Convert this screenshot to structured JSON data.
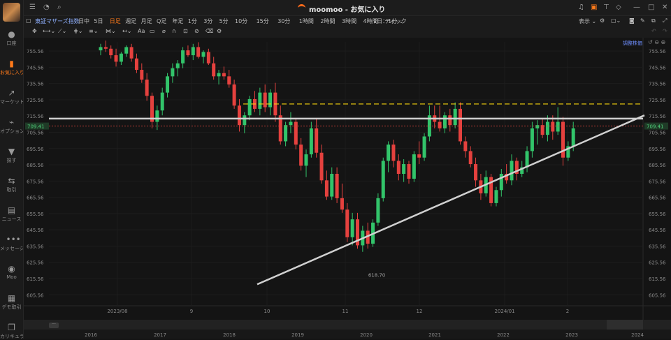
{
  "window": {
    "app_title": "moomoo - お気に入り",
    "icons": [
      "list-icon",
      "bell-icon",
      "search-icon",
      "headset-icon",
      "lock-icon",
      "shirt-icon",
      "bell-icon",
      "minimize-icon",
      "maximize-icon",
      "close-icon"
    ]
  },
  "sidebar": {
    "items": [
      {
        "label": "口座",
        "icon": "user-icon"
      },
      {
        "label": "お気に入り",
        "icon": "chart-bars-icon",
        "active": true
      },
      {
        "label": "マーケット",
        "icon": "trend-icon"
      },
      {
        "label": "オプション",
        "icon": "option-chart-icon"
      },
      {
        "label": "探す",
        "icon": "filter-icon"
      },
      {
        "label": "取引",
        "icon": "trade-icon"
      },
      {
        "label": "ニュース",
        "icon": "news-icon"
      },
      {
        "label": "メッセージ",
        "icon": "message-icon"
      },
      {
        "label": "Moo",
        "icon": "moo-icon"
      },
      {
        "label": "デモ取引",
        "icon": "game-icon"
      },
      {
        "label": "カリキュラム",
        "icon": "curriculum-icon"
      }
    ]
  },
  "toolbar": {
    "symbol": "東証マザーズ指数",
    "timeframes": [
      "日中",
      "5日",
      "日足",
      "週足",
      "月足",
      "Q足",
      "年足",
      "1分",
      "3分",
      "5分",
      "10分",
      "15分",
      "30分",
      "1時間",
      "2時間",
      "3時間",
      "4時間",
      "ティック"
    ],
    "active_timeframe": "日足",
    "interval_select": "1日：1分",
    "display_label": "表示",
    "adjust_label": "調整株価"
  },
  "chart_data": {
    "type": "candlestick",
    "price_axis_ticks": [
      755.56,
      745.56,
      735.56,
      725.56,
      715.56,
      705.56,
      695.56,
      685.56,
      675.56,
      665.56,
      655.56,
      645.56,
      635.56,
      625.56,
      615.56,
      605.56
    ],
    "current_price": "709.41",
    "time_labels": [
      "2023/08",
      "9",
      "10",
      "11",
      "12",
      "2024/01",
      "2"
    ],
    "navigator_years": [
      "2016",
      "2017",
      "2018",
      "2019",
      "2020",
      "2021",
      "2022",
      "2023",
      "2024"
    ],
    "annotations": {
      "low_label": "618.70"
    },
    "horizontal_lines": [
      {
        "style": "dashed",
        "color": "#f5d20c",
        "value": 723
      },
      {
        "style": "solid",
        "color": "#d0d0d0",
        "value": 714
      },
      {
        "style": "dotted",
        "color": "#d9433c",
        "value": 709.41
      }
    ],
    "trendline": {
      "color": "#d0d0d0",
      "from": [
        "2023/09/26",
        612
      ],
      "to": [
        "2024/02/20",
        716
      ]
    },
    "colors": {
      "up": "#32c46a",
      "down": "#e5413e"
    },
    "candles": [
      [
        0,
        756,
        760,
        753,
        758
      ],
      [
        1,
        758,
        762,
        755,
        757
      ],
      [
        2,
        757,
        759,
        751,
        753
      ],
      [
        3,
        753,
        757,
        746,
        749
      ],
      [
        4,
        749,
        755,
        747,
        754
      ],
      [
        5,
        754,
        759,
        752,
        758
      ],
      [
        6,
        758,
        760,
        749,
        751
      ],
      [
        7,
        751,
        754,
        742,
        744
      ],
      [
        8,
        744,
        748,
        736,
        738
      ],
      [
        9,
        738,
        742,
        725,
        728
      ],
      [
        10,
        728,
        730,
        708,
        712
      ],
      [
        11,
        712,
        722,
        707,
        719
      ],
      [
        12,
        719,
        733,
        716,
        730
      ],
      [
        13,
        730,
        742,
        727,
        740
      ],
      [
        14,
        740,
        748,
        736,
        745
      ],
      [
        15,
        745,
        750,
        740,
        748
      ],
      [
        16,
        748,
        758,
        745,
        756
      ],
      [
        17,
        756,
        759,
        752,
        753
      ],
      [
        18,
        753,
        760,
        750,
        758
      ],
      [
        19,
        758,
        761,
        751,
        752
      ],
      [
        20,
        752,
        756,
        748,
        755
      ],
      [
        21,
        755,
        757,
        747,
        748
      ],
      [
        22,
        748,
        752,
        738,
        740
      ],
      [
        23,
        740,
        744,
        735,
        742
      ],
      [
        24,
        742,
        746,
        738,
        740
      ],
      [
        25,
        740,
        744,
        733,
        735
      ],
      [
        26,
        735,
        738,
        720,
        722
      ],
      [
        27,
        722,
        726,
        706,
        710
      ],
      [
        28,
        710,
        718,
        705,
        716
      ],
      [
        29,
        716,
        728,
        713,
        726
      ],
      [
        30,
        726,
        731,
        718,
        720
      ],
      [
        31,
        720,
        733,
        716,
        730
      ],
      [
        32,
        730,
        735,
        718,
        721
      ],
      [
        33,
        721,
        732,
        716,
        730
      ],
      [
        34,
        730,
        736,
        712,
        716
      ],
      [
        35,
        716,
        722,
        698,
        700
      ],
      [
        36,
        700,
        712,
        697,
        710
      ],
      [
        37,
        710,
        718,
        705,
        712
      ],
      [
        38,
        712,
        714,
        695,
        698
      ],
      [
        39,
        698,
        702,
        682,
        685
      ],
      [
        40,
        685,
        695,
        678,
        692
      ],
      [
        41,
        692,
        712,
        690,
        708
      ],
      [
        42,
        708,
        714,
        690,
        693
      ],
      [
        43,
        693,
        698,
        674,
        676
      ],
      [
        44,
        676,
        682,
        664,
        666
      ],
      [
        45,
        666,
        684,
        664,
        680
      ],
      [
        46,
        680,
        684,
        662,
        665
      ],
      [
        47,
        665,
        674,
        656,
        658
      ],
      [
        48,
        658,
        662,
        638,
        641
      ],
      [
        49,
        641,
        656,
        636,
        652
      ],
      [
        50,
        652,
        656,
        634,
        636
      ],
      [
        51,
        636,
        648,
        632,
        645
      ],
      [
        52,
        645,
        650,
        634,
        637
      ],
      [
        53,
        637,
        652,
        635,
        650
      ],
      [
        54,
        650,
        668,
        648,
        665
      ],
      [
        55,
        665,
        690,
        663,
        688
      ],
      [
        56,
        688,
        700,
        681,
        698
      ],
      [
        57,
        698,
        701,
        684,
        688
      ],
      [
        58,
        688,
        692,
        676,
        680
      ],
      [
        59,
        680,
        689,
        675,
        686
      ],
      [
        60,
        686,
        688,
        674,
        677
      ],
      [
        61,
        677,
        694,
        675,
        692
      ],
      [
        62,
        692,
        700,
        686,
        690
      ],
      [
        63,
        690,
        705,
        688,
        703
      ],
      [
        64,
        703,
        722,
        700,
        716
      ],
      [
        65,
        716,
        722,
        708,
        712
      ],
      [
        66,
        712,
        722,
        706,
        708
      ],
      [
        67,
        708,
        718,
        705,
        716
      ],
      [
        68,
        716,
        720,
        706,
        710
      ],
      [
        69,
        710,
        724,
        708,
        720
      ],
      [
        70,
        720,
        724,
        698,
        700
      ],
      [
        71,
        700,
        703,
        690,
        694
      ],
      [
        72,
        694,
        697,
        684,
        686
      ],
      [
        73,
        686,
        690,
        672,
        676
      ],
      [
        74,
        676,
        680,
        664,
        668
      ],
      [
        75,
        668,
        682,
        666,
        678
      ],
      [
        76,
        678,
        680,
        660,
        662
      ],
      [
        77,
        662,
        672,
        660,
        670
      ],
      [
        78,
        670,
        683,
        666,
        680
      ],
      [
        79,
        680,
        686,
        674,
        676
      ],
      [
        80,
        676,
        692,
        673,
        688
      ],
      [
        81,
        688,
        690,
        676,
        680
      ],
      [
        82,
        680,
        688,
        678,
        684
      ],
      [
        83,
        684,
        697,
        681,
        694
      ],
      [
        84,
        694,
        712,
        690,
        708
      ],
      [
        85,
        708,
        713,
        698,
        710
      ],
      [
        86,
        710,
        714,
        702,
        704
      ],
      [
        87,
        704,
        716,
        700,
        712
      ],
      [
        88,
        712,
        716,
        701,
        706
      ],
      [
        89,
        706,
        721,
        704,
        712
      ],
      [
        90,
        712,
        715,
        685,
        690
      ],
      [
        91,
        690,
        700,
        688,
        697
      ],
      [
        92,
        697,
        712,
        694,
        708
      ]
    ]
  }
}
